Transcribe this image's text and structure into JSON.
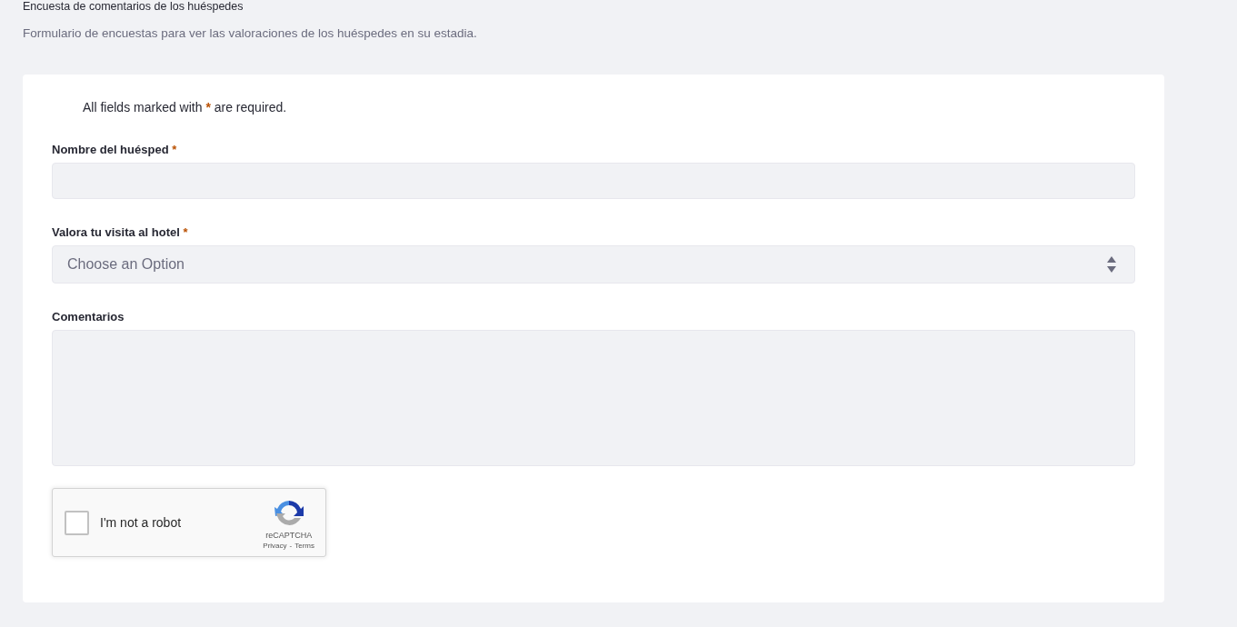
{
  "header": {
    "title": "Encuesta de comentarios de los huéspedes",
    "description": "Formulario de encuestas para ver las valoraciones de los huéspedes en su estadia."
  },
  "form": {
    "required_note": {
      "before": "All fields marked with",
      "mark": "*",
      "after": "are required."
    },
    "fields": [
      {
        "kind": "text",
        "label": "Nombre del huésped",
        "required_mark": "*"
      },
      {
        "kind": "select",
        "label": "Valora tu visita al hotel",
        "required_mark": "*",
        "placeholder": "Choose an Option"
      },
      {
        "kind": "textarea",
        "label": "Comentarios"
      }
    ],
    "captcha": {
      "label": "I'm not a robot",
      "checked": false,
      "brand": "reCAPTCHA",
      "links": [
        "Privacy",
        "Terms"
      ],
      "separator": "-"
    }
  }
}
